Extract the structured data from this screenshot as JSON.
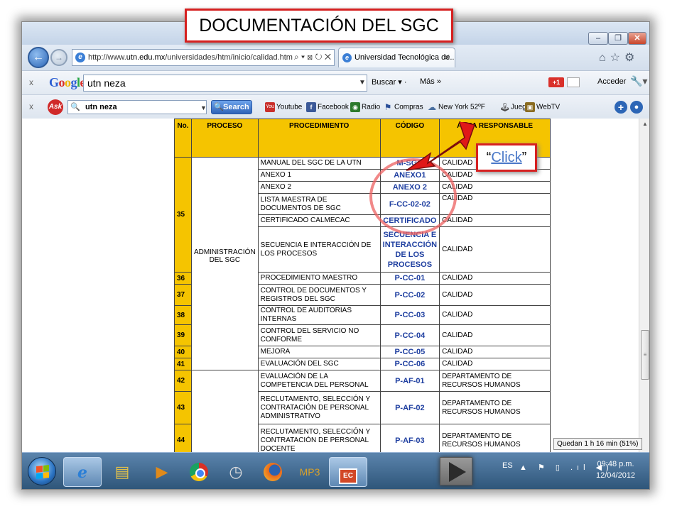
{
  "slide": {
    "title": "DOCUMENTACIÓN DEL SGC",
    "callout_open": "“",
    "callout_link": "Click",
    "callout_close": "”"
  },
  "browser": {
    "url_prefix": "http://www.",
    "url_domain": "utn.edu.mx",
    "url_rest": "/universidades/htm/inicio/calidad.htm",
    "addr_tools": "⌕ ▾ ⊠ ↻ ✕",
    "tab_title": "Universidad Tecnológica de...",
    "tab_close": "✕",
    "toolbar_icons": "⌂☆⚙",
    "win_min": "–",
    "win_max": "❐",
    "win_close": "✕"
  },
  "google_toolbar": {
    "close": "x",
    "logo": [
      "G",
      "o",
      "o",
      "g",
      "l",
      "e"
    ],
    "query": "utn neza",
    "buscar": "Buscar ▾ ·",
    "mas": "Más »",
    "gplus": "+1",
    "acceder": "Acceder",
    "wrench": "🔧▾"
  },
  "ask_toolbar": {
    "close": "x",
    "logo": "Ask",
    "query": "utn neza",
    "search_label": "Search",
    "items": {
      "youtube": "Youtube",
      "facebook": "Facebook",
      "radio": "Radio",
      "compras": "Compras",
      "weather": "New York 52ºF",
      "juegos": "Juegos",
      "webtv": "WebTV"
    },
    "icons": {
      "youtube": "You",
      "facebook": "f",
      "radio": "◉",
      "compras": "⚑",
      "weather": "☁",
      "juegos": "🕹",
      "webtv": "▣"
    }
  },
  "table": {
    "headers": [
      "No.",
      "PROCESO",
      "PROCEDIMIENTO",
      "CÓDIGO",
      "ÁREA RESPONSABLE"
    ],
    "num_35": "35",
    "num_36": "36",
    "num_37": "37",
    "num_38": "38",
    "num_39": "39",
    "num_40": "40",
    "num_41": "41",
    "num_42": "42",
    "num_43": "43",
    "num_44": "44",
    "process_sgc": "ADMINISTRACIÓN DEL SGC",
    "rows": [
      {
        "proc": "MANUAL DEL SGC DE LA UTN",
        "code": "M-SGC",
        "area": "CALIDAD"
      },
      {
        "proc": "ANEXO 1",
        "code": "ANEXO1",
        "area": "CALIDAD"
      },
      {
        "proc": "ANEXO 2",
        "code": "ANEXO 2",
        "area": "CALIDAD"
      },
      {
        "proc": "LISTA MAESTRA DE DOCUMENTOS DE SGC",
        "code": "F-CC-02-02",
        "area": "CALIDAD"
      },
      {
        "proc": "CERTIFICADO CALMECAC",
        "code": "CERTIFICADO",
        "area": "CALIDAD"
      },
      {
        "proc": "SECUENCIA E INTERACCIÓN DE LOS PROCESOS",
        "code": "SECUENCIA E INTERACCIÓN DE LOS PROCESOS",
        "area": "CALIDAD"
      },
      {
        "proc": "PROCEDIMIENTO MAESTRO",
        "code": "P-CC-01",
        "area": "CALIDAD"
      },
      {
        "proc": "CONTROL DE DOCUMENTOS Y REGISTROS DEL SGC",
        "code": "P-CC-02",
        "area": "CALIDAD"
      },
      {
        "proc": "CONTROL DE AUDITORIAS INTERNAS",
        "code": "P-CC-03",
        "area": "CALIDAD"
      },
      {
        "proc": "CONTROL DEL SERVICIO NO CONFORME",
        "code": "P-CC-04",
        "area": "CALIDAD"
      },
      {
        "proc": "MEJORA",
        "code": "P-CC-05",
        "area": "CALIDAD"
      },
      {
        "proc": "EVALUACIÓN  DEL SGC",
        "code": "P-CC-06",
        "area": "CALIDAD"
      },
      {
        "proc": "EVALUACIÓN DE LA COMPETENCIA DEL PERSONAL",
        "code": "P-AF-01",
        "area": "DEPARTAMENTO DE RECURSOS HUMANOS"
      },
      {
        "proc": "RECLUTAMENTO, SELECCIÓN Y CONTRATACIÓN DE PERSONAL ADMINISTRATIVO",
        "code": "P-AF-02",
        "area": "DEPARTAMENTO DE RECURSOS HUMANOS"
      },
      {
        "proc": "RECLUTAMENTO, SELECCIÓN Y CONTRATACIÓN DE PERSONAL DOCENTE",
        "code": "P-AF-03",
        "area": "DEPARTAMENTO DE RECURSOS HUMANOS"
      }
    ]
  },
  "taskbar": {
    "mp3": "MP3",
    "ppt": "EC",
    "lang": "ES",
    "tray": "▲ ⚑ ▯ .ıl ◀)",
    "time": "09:48 p.m.",
    "date": "12/04/2012",
    "battery_tip": "Quedan 1 h 16 min (51%)"
  }
}
